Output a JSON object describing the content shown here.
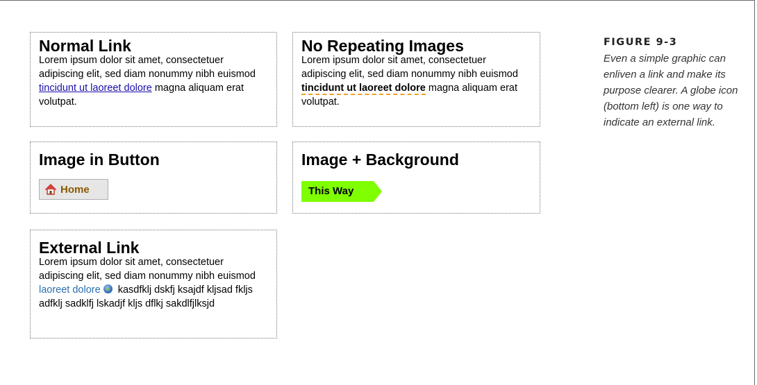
{
  "normal": {
    "title": "Normal Link",
    "text_before": "Lorem ipsum dolor sit amet, consectetuer adipiscing elit, sed diam nonummy nibh euismod ",
    "link": "tincidunt ut laoreet dolore",
    "text_after": " magna aliquam erat volutpat."
  },
  "norepeat": {
    "title": "No Repeating Images",
    "text_before": "Lorem ipsum dolor sit amet, consectetuer adipiscing elit, sed diam nonummy nibh euismod ",
    "link": "tincidunt ut laoreet dolore",
    "text_after": " magna aliquam erat volutpat."
  },
  "image_button": {
    "title": "Image in Button",
    "button_label": "Home",
    "icon": "house-icon"
  },
  "image_background": {
    "title": "Image + Background",
    "button_label": "This Way",
    "accent_color": "#7fff00"
  },
  "external": {
    "title": "External Link",
    "text_before": "Lorem ipsum dolor sit amet, consectetuer adipiscing elit, sed diam nonummy nibh euismod ",
    "link": "laoreet dolore",
    "icon": "globe-icon",
    "text_after": " kasdfklj dskfj ksajdf kljsad fkljs adfklj sadklfj lskadjf kljs dflkj sakdlfjlksjd"
  },
  "caption": {
    "figure": "FIGURE 9-3",
    "text": "Even a simple graphic can enliven a link and make its purpose clearer. A globe icon (bottom left) is one way to indicate an external link."
  }
}
